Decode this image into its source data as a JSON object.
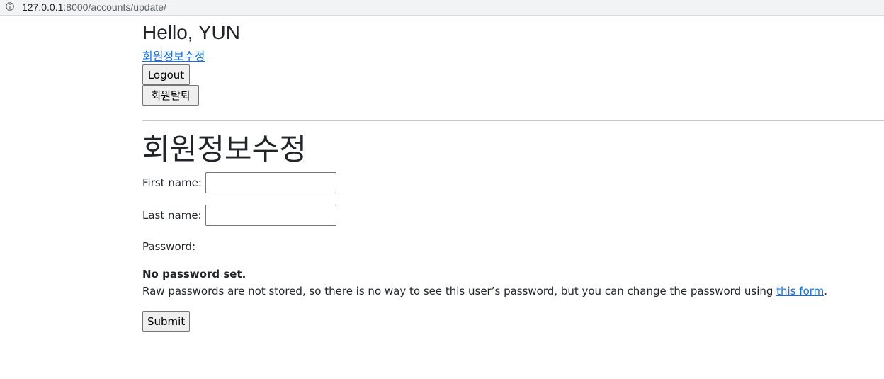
{
  "browser": {
    "url_host": "127.0.0.1",
    "url_rest": ":8000/accounts/update/"
  },
  "header": {
    "greeting": "Hello, YUN",
    "profile_link": "회원정보수정",
    "logout_label": "Logout",
    "withdraw_label": "회원탈퇴"
  },
  "main": {
    "title": "회원정보수정",
    "form": {
      "first_name_label": "First name:",
      "first_name_value": "",
      "last_name_label": "Last name:",
      "last_name_value": "",
      "password_label": "Password:",
      "no_password_text": "No password set.",
      "help_text_before": "Raw passwords are not stored, so there is no way to see this user’s password, but you can change the password using ",
      "help_link": "this form",
      "help_text_after": ".",
      "submit_label": "Submit"
    }
  }
}
